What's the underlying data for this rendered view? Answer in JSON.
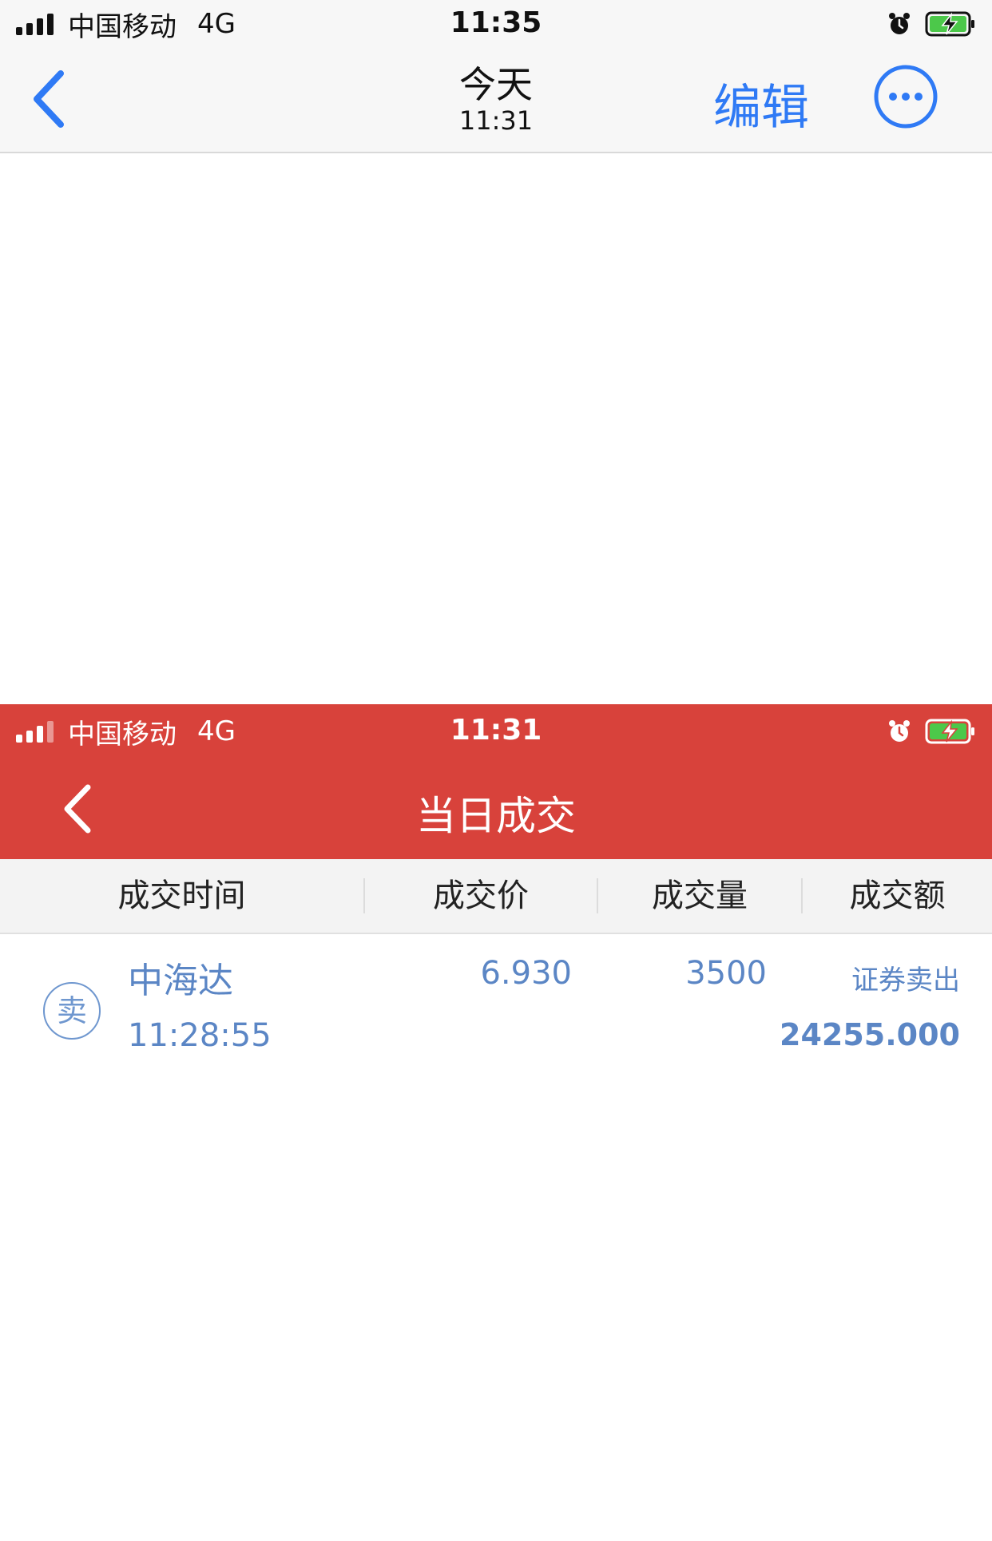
{
  "outer_status": {
    "carrier": "中国移动",
    "network": "4G",
    "time": "11:35",
    "alarm_icon": "alarm-clock-icon",
    "battery_icon": "battery-charging-icon"
  },
  "outer_nav": {
    "title": "今天",
    "subtitle": "11:31",
    "edit_label": "编辑",
    "more_icon": "more-icon",
    "back_icon": "chevron-left-icon"
  },
  "inner_status": {
    "carrier": "中国移动",
    "network": "4G",
    "time": "11:31"
  },
  "inner_nav": {
    "title": "当日成交"
  },
  "table": {
    "headers": [
      "成交时间",
      "成交价",
      "成交量",
      "成交额"
    ],
    "rows": [
      {
        "badge": "卖",
        "name": "中海达",
        "time": "11:28:55",
        "price": "6.930",
        "quantity": "3500",
        "type": "证券卖出",
        "amount": "24255.000"
      }
    ]
  },
  "colors": {
    "accent_blue": "#2f7af5",
    "header_red": "#d8423b",
    "row_text_blue": "#5b86c5"
  }
}
